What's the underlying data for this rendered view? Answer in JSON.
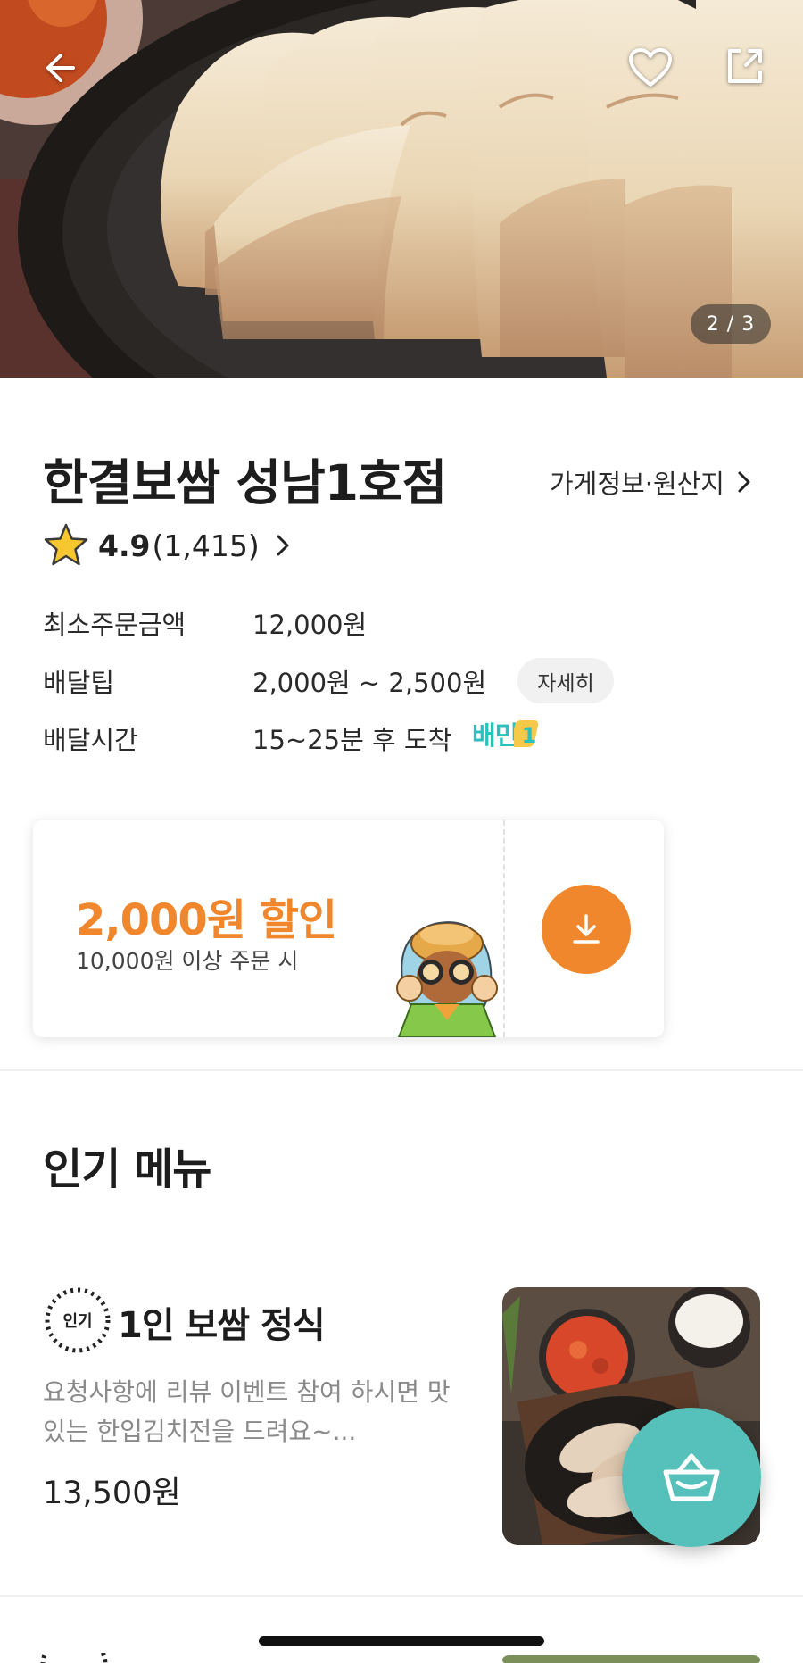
{
  "hero": {
    "image_counter": "2 / 3",
    "icons": {
      "back": "arrow-left-icon",
      "favorite": "heart-icon",
      "share": "share-icon"
    }
  },
  "store": {
    "name": "한결보쌈 성남1호점",
    "info_link": "가게정보·원산지",
    "rating": "4.9",
    "review_count": "(1,415)",
    "min_order_label": "최소주문금액",
    "min_order_value": "12,000원",
    "delivery_tip_label": "배달팁",
    "delivery_tip_value": "2,000원 ~ 2,500원",
    "detail_button": "자세히",
    "delivery_time_label": "배달시간",
    "delivery_time_value": "15~25분 후 도착",
    "badge_text": "배민",
    "badge_number": "1"
  },
  "coupon": {
    "amount": "2,000원 할인",
    "condition": "10,000원 이상 주문 시"
  },
  "popular": {
    "title": "인기 메뉴",
    "items": [
      {
        "badge": "인기",
        "name": "1인 보쌈 정식",
        "description": "요청사항에 리뷰 이벤트 참여 하시면 맛있는 한입김치전을 드려요~...",
        "price": "13,500원"
      }
    ]
  },
  "colors": {
    "accent_orange": "#f0872c",
    "mint": "#2ac1bc",
    "cart_fab": "#56c1bb"
  }
}
